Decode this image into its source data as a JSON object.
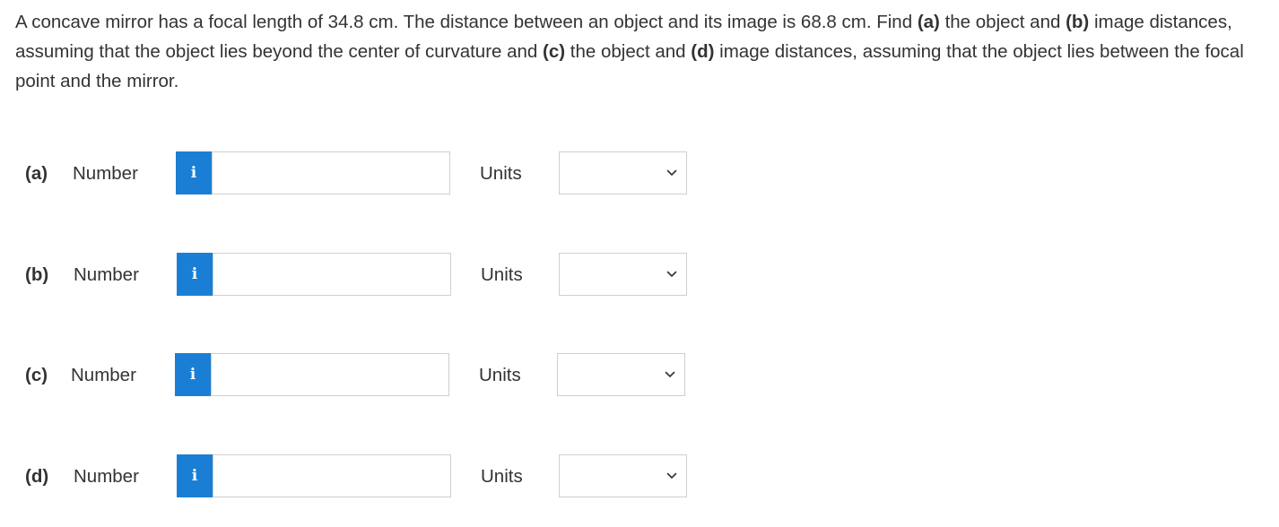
{
  "question": {
    "t1": "A concave mirror has a focal length of 34.8 cm. The distance between an object and its image is 68.8 cm. Find ",
    "p_a": "(a)",
    "t2": " the object and ",
    "p_b": "(b)",
    "t3": " image distances, assuming that the object lies beyond the center of curvature and ",
    "p_c": "(c)",
    "t4": " the object and ",
    "p_d": "(d)",
    "t5": " image distances, assuming that the object lies between the focal point and the mirror."
  },
  "parts": [
    {
      "label": "(a)",
      "number_label": "Number",
      "info_glyph": "i",
      "value": "",
      "units_label": "Units",
      "units_value": ""
    },
    {
      "label": "(b)",
      "number_label": "Number",
      "info_glyph": "i",
      "value": "",
      "units_label": "Units",
      "units_value": ""
    },
    {
      "label": "(c)",
      "number_label": "Number",
      "info_glyph": "i",
      "value": "",
      "units_label": "Units",
      "units_value": ""
    },
    {
      "label": "(d)",
      "number_label": "Number",
      "info_glyph": "i",
      "value": "",
      "units_label": "Units",
      "units_value": ""
    }
  ],
  "icons": {
    "info": "info-icon",
    "dropdown": "chevron-down-icon"
  },
  "colors": {
    "info_button": "#1a7fd4",
    "input_border": "#cfcfcf",
    "text": "#333333"
  }
}
